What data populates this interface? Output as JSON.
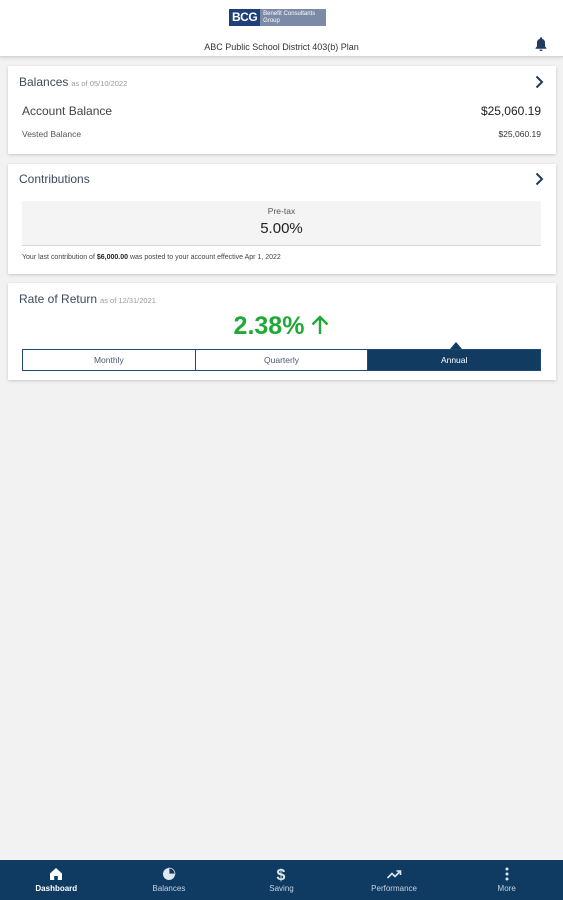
{
  "header": {
    "logo_mark": "BCG",
    "logo_text": "Benefit Consultants Group",
    "plan_name": "ABC Public School District 403(b) Plan",
    "bell_icon": "bell-icon"
  },
  "balances": {
    "title": "Balances",
    "as_of": "as of 05/10/2022",
    "account_label": "Account Balance",
    "account_value": "$25,060.19",
    "vested_label": "Vested Balance",
    "vested_value": "$25,060.19"
  },
  "contributions": {
    "title": "Contributions",
    "pretax_label": "Pre-tax",
    "pretax_value": "5.00%",
    "note_before": "Your last contribution of ",
    "note_amount": "$6,000.00",
    "note_after": " was posted to your account effective Apr 1, 2022"
  },
  "rate_of_return": {
    "title": "Rate of Return",
    "as_of": "as of 12/31/2021",
    "value": "2.38%",
    "trend_color": "#1faa38",
    "periods": [
      "Monthly",
      "Quarterly",
      "Annual"
    ],
    "selected": "Annual"
  },
  "tabbar": {
    "items": [
      {
        "label": "Dashboard",
        "icon": "home-icon"
      },
      {
        "label": "Balances",
        "icon": "pie-chart-icon"
      },
      {
        "label": "Saving",
        "icon": "dollar-icon"
      },
      {
        "label": "Performance",
        "icon": "trending-up-icon"
      },
      {
        "label": "More",
        "icon": "more-vertical-icon"
      }
    ],
    "active": "Dashboard"
  },
  "colors": {
    "brand_navy": "#0f3b62",
    "accent_green": "#1faa38",
    "background": "#f2f2f2"
  }
}
